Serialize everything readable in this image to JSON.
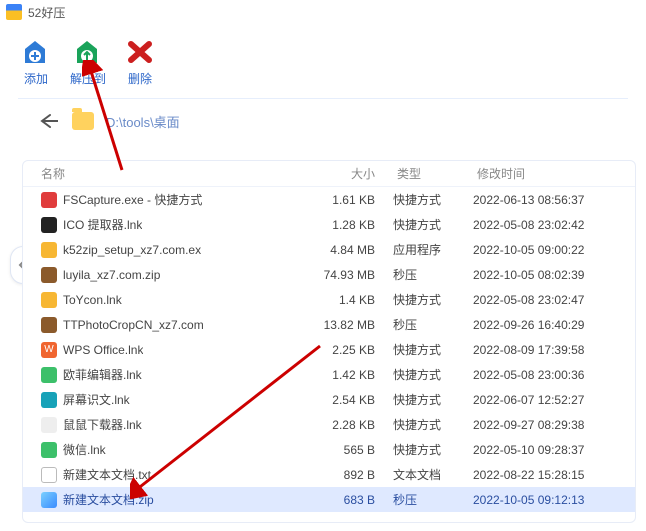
{
  "app": {
    "title": "52好压"
  },
  "toolbar": {
    "add_label": "添加",
    "extract_label": "解压到",
    "delete_label": "删除"
  },
  "path": {
    "text": "D:\\tools\\桌面"
  },
  "columns": {
    "name": "名称",
    "size": "大小",
    "type": "类型",
    "date": "修改时间"
  },
  "icons": {
    "add": "add-archive-icon",
    "extract": "extract-archive-icon",
    "delete": "delete-x-icon",
    "back": "back-arrow-icon",
    "folder": "folder-icon",
    "nav": "chevron-left-icon"
  },
  "files": [
    {
      "name": "FSCapture.exe - 快捷方式",
      "size": "1.61 KB",
      "type": "快捷方式",
      "date": "2022-06-13 08:56:37",
      "icon": "ic-red",
      "selected": false
    },
    {
      "name": "ICO 提取器.lnk",
      "size": "1.28 KB",
      "type": "快捷方式",
      "date": "2022-05-08 23:02:42",
      "icon": "ic-black",
      "selected": false
    },
    {
      "name": "k52zip_setup_xz7.com.ex",
      "size": "4.84 MB",
      "type": "应用程序",
      "date": "2022-10-05 09:00:22",
      "icon": "ic-yellow",
      "selected": false
    },
    {
      "name": "luyila_xz7.com.zip",
      "size": "74.93 MB",
      "type": "秒压",
      "date": "2022-10-05 08:02:39",
      "icon": "ic-brown",
      "selected": false
    },
    {
      "name": "ToYcon.lnk",
      "size": "1.4 KB",
      "type": "快捷方式",
      "date": "2022-05-08 23:02:47",
      "icon": "ic-yellow",
      "selected": false
    },
    {
      "name": "TTPhotoCropCN_xz7.com",
      "size": "13.82 MB",
      "type": "秒压",
      "date": "2022-09-26 16:40:29",
      "icon": "ic-brown",
      "selected": false
    },
    {
      "name": "WPS Office.lnk",
      "size": "2.25 KB",
      "type": "快捷方式",
      "date": "2022-08-09 17:39:58",
      "icon": "ic-orange",
      "selected": false
    },
    {
      "name": "欧菲编辑器.lnk",
      "size": "1.42 KB",
      "type": "快捷方式",
      "date": "2022-05-08 23:00:36",
      "icon": "ic-green",
      "selected": false
    },
    {
      "name": "屏幕识文.lnk",
      "size": "2.54 KB",
      "type": "快捷方式",
      "date": "2022-06-07 12:52:27",
      "icon": "ic-teal",
      "selected": false
    },
    {
      "name": "鼠鼠下载器.lnk",
      "size": "2.28 KB",
      "type": "快捷方式",
      "date": "2022-09-27 08:29:38",
      "icon": "ic-generic",
      "selected": false
    },
    {
      "name": "微信.lnk",
      "size": "565 B",
      "type": "快捷方式",
      "date": "2022-05-10 09:28:37",
      "icon": "ic-green",
      "selected": false
    },
    {
      "name": "新建文本文档.txt",
      "size": "892 B",
      "type": "文本文档",
      "date": "2022-08-22 15:28:15",
      "icon": "ic-doc",
      "selected": false
    },
    {
      "name": "新建文本文档.zip",
      "size": "683 B",
      "type": "秒压",
      "date": "2022-10-05 09:12:13",
      "icon": "ic-zip",
      "selected": true
    }
  ]
}
